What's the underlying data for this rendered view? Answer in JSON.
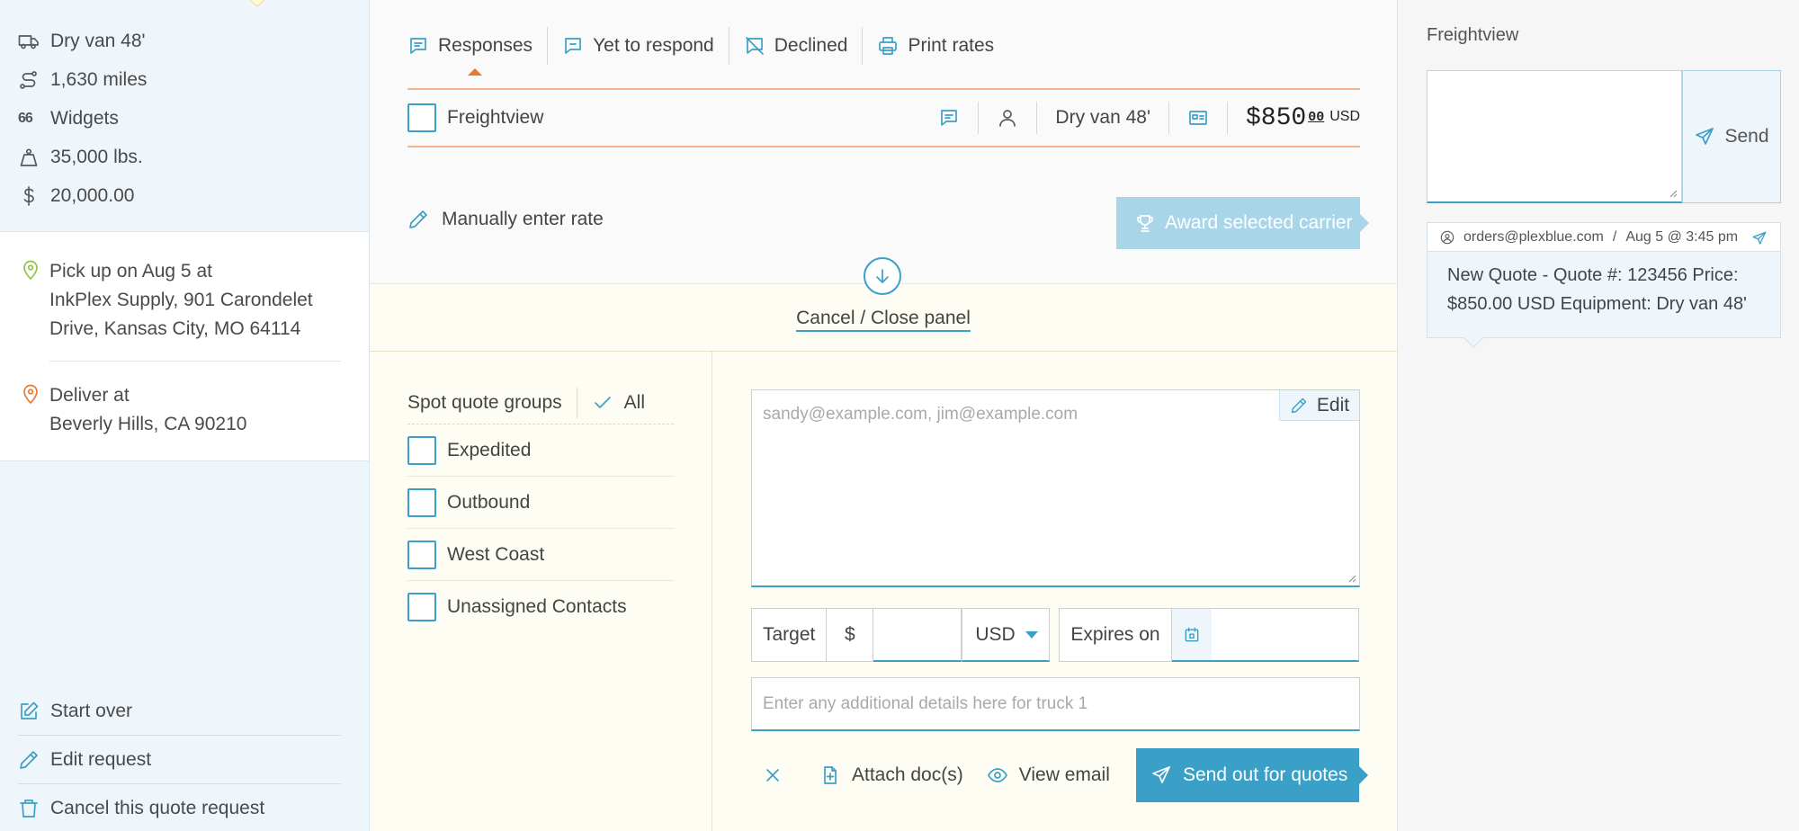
{
  "colors": {
    "accent": "#3aa0c8",
    "award_disabled": "#a8d6e8",
    "tab_indicator": "#ea7a2b",
    "row_border": "#f1b48a",
    "panel_bg": "#fefdf3",
    "sidebar_bg": "#eef6fc"
  },
  "shipment": {
    "equipment": "Dry van 48'",
    "distance": "1,630 miles",
    "commodity_icon": "66",
    "commodity": "Widgets",
    "weight": "35,000 lbs.",
    "value": "20,000.00"
  },
  "pickup": {
    "line1": "Pick up on Aug 5 at",
    "line2": "InkPlex Supply, 901 Carondelet",
    "line3": "Drive, Kansas City, MO 64114"
  },
  "delivery": {
    "line1": "Deliver at",
    "line2": "Beverly Hills, CA 90210"
  },
  "left_actions": {
    "start_over": "Start over",
    "edit_request": "Edit request",
    "cancel_request": "Cancel this quote request"
  },
  "tabs": {
    "responses": "Responses",
    "yet_to_respond": "Yet to respond",
    "declined": "Declined",
    "print_rates": "Print rates"
  },
  "response": {
    "carrier": "Freightview",
    "equipment": "Dry van 48'",
    "price_dollars": "$850",
    "price_cents": "00",
    "currency": "USD"
  },
  "manual_rate": "Manually enter rate",
  "award_button": "Award selected carrier",
  "panel": {
    "cancel_close": "Cancel / Close panel",
    "groups_title": "Spot quote groups",
    "groups_all": "All",
    "groups": [
      "Expedited",
      "Outbound",
      "West Coast",
      "Unassigned Contacts"
    ],
    "email_placeholder": "sandy@example.com, jim@example.com",
    "edit_label": "Edit",
    "target_label": "Target",
    "dollar_sign": "$",
    "target_currency": "USD",
    "expires_label": "Expires on",
    "details_placeholder": "Enter any additional details here for truck 1",
    "attach": "Attach doc(s)",
    "view_email": "View email",
    "send_quotes": "Send out for quotes"
  },
  "messages": {
    "title": "Freightview",
    "send": "Send",
    "card": {
      "from": "orders@plexblue.com",
      "separator": "/",
      "time": "Aug 5 @ 3:45 pm",
      "body": "New Quote - Quote #: 123456 Price: $850.00 USD Equipment: Dry van 48'"
    }
  }
}
